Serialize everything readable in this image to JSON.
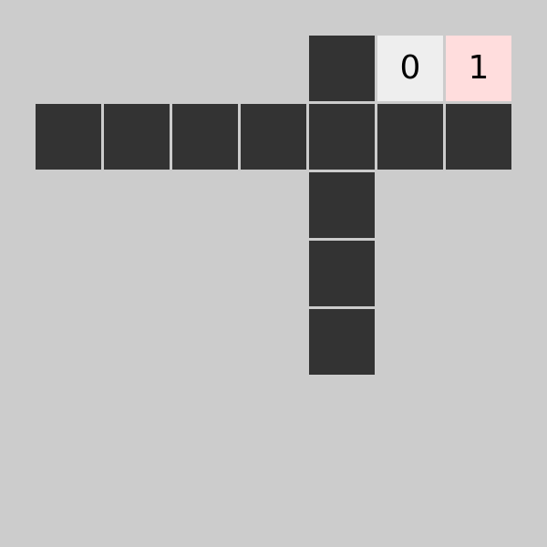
{
  "board": {
    "background": "#cccccc",
    "cell_colors": {
      "dark": "#333333",
      "light": "#eeeeee",
      "pink": "#ffdddd"
    },
    "cells": [
      {
        "col": 4,
        "row": 0,
        "style": "dark",
        "text": ""
      },
      {
        "col": 5,
        "row": 0,
        "style": "light",
        "text": "0"
      },
      {
        "col": 6,
        "row": 0,
        "style": "pink",
        "text": "1"
      },
      {
        "col": 0,
        "row": 1,
        "style": "dark",
        "text": ""
      },
      {
        "col": 1,
        "row": 1,
        "style": "dark",
        "text": ""
      },
      {
        "col": 2,
        "row": 1,
        "style": "dark",
        "text": ""
      },
      {
        "col": 3,
        "row": 1,
        "style": "dark",
        "text": ""
      },
      {
        "col": 4,
        "row": 1,
        "style": "dark",
        "text": ""
      },
      {
        "col": 5,
        "row": 1,
        "style": "dark",
        "text": ""
      },
      {
        "col": 6,
        "row": 1,
        "style": "dark",
        "text": ""
      },
      {
        "col": 4,
        "row": 2,
        "style": "dark",
        "text": ""
      },
      {
        "col": 4,
        "row": 3,
        "style": "dark",
        "text": ""
      },
      {
        "col": 4,
        "row": 4,
        "style": "dark",
        "text": ""
      }
    ]
  }
}
